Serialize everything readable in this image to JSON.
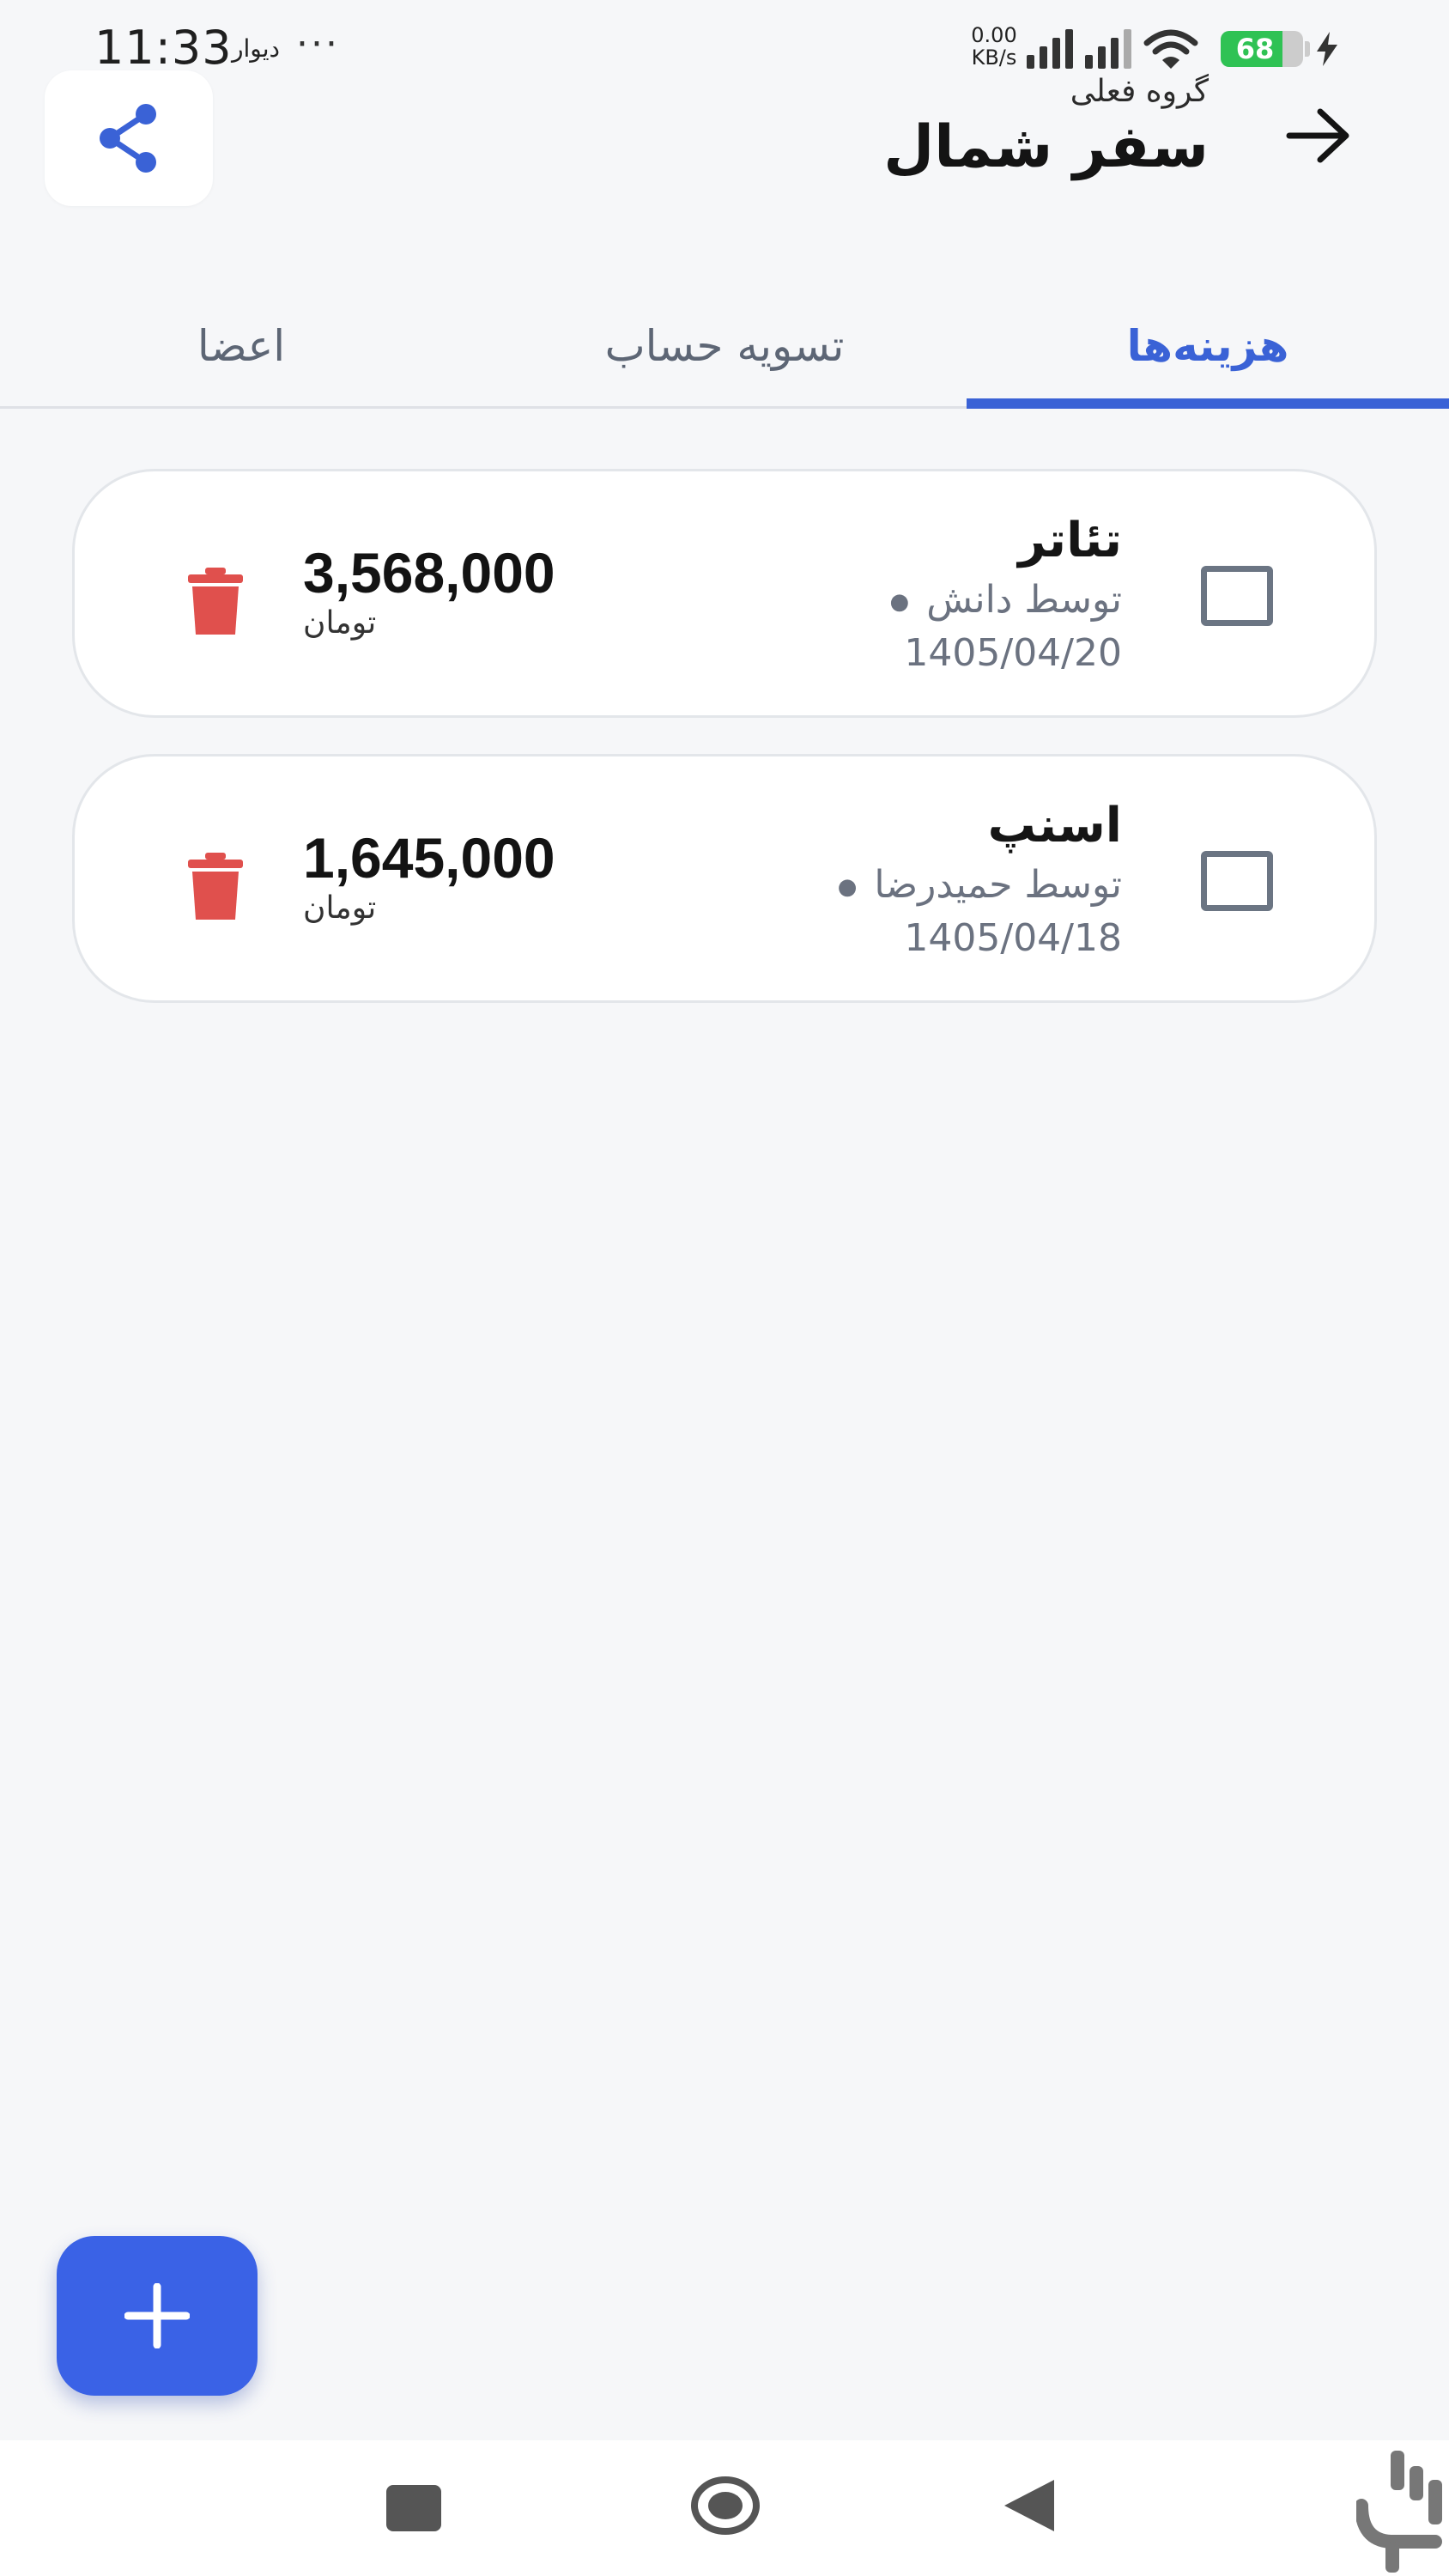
{
  "status_bar": {
    "time": "11:33",
    "app_label": "دیوار",
    "more": "···",
    "net_speed": "0.00",
    "net_unit": "KB/s",
    "battery": "68"
  },
  "header": {
    "group_label": "گروه فعلی",
    "group_name": "سفر شمال",
    "share_icon": "share-icon",
    "back_icon": "arrow-right-icon"
  },
  "tabs": [
    {
      "label": "هزینه‌ها",
      "active": true
    },
    {
      "label": "تسویه حساب",
      "active": false
    },
    {
      "label": "اعضا",
      "active": false
    }
  ],
  "expenses": [
    {
      "title": "تئاتر",
      "payer": "توسط دانش",
      "date": "1405/04/20",
      "amount": "3,568,000",
      "currency": "تومان"
    },
    {
      "title": "اسنپ",
      "payer": "توسط حمیدرضا",
      "date": "1405/04/18",
      "amount": "1,645,000",
      "currency": "تومان"
    }
  ],
  "fab": {
    "icon": "plus-icon"
  },
  "colors": {
    "accent": "#3a62d6",
    "fab": "#3a62e6",
    "danger": "#e0504d",
    "background": "#f6f7f9"
  }
}
